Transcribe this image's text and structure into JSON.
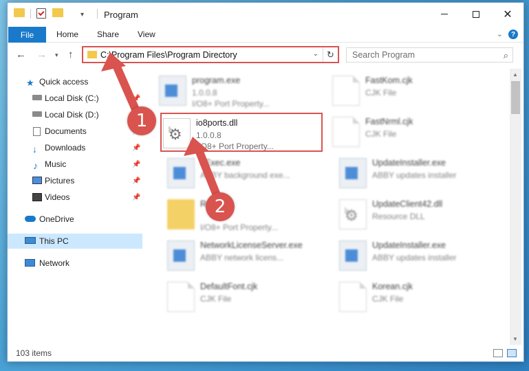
{
  "window": {
    "title": "Program"
  },
  "ribbon": {
    "file": "File",
    "home": "Home",
    "share": "Share",
    "view": "View",
    "help": "?"
  },
  "address": {
    "path": "C:\\Program Files\\Program Directory",
    "search_placeholder": "Search Program"
  },
  "nav_pane": {
    "items": [
      {
        "label": "Quick access",
        "icon": "star-icon",
        "pinned": false
      },
      {
        "label": "Local Disk (C:)",
        "icon": "drive-icon",
        "pinned": true
      },
      {
        "label": "Local Disk (D:)",
        "icon": "drive-icon",
        "pinned": false
      },
      {
        "label": "Documents",
        "icon": "documents-icon",
        "pinned": true
      },
      {
        "label": "Downloads",
        "icon": "download-icon",
        "pinned": true
      },
      {
        "label": "Music",
        "icon": "music-icon",
        "pinned": true
      },
      {
        "label": "Pictures",
        "icon": "pictures-icon",
        "pinned": true
      },
      {
        "label": "Videos",
        "icon": "videos-icon",
        "pinned": true
      },
      {
        "label": "OneDrive",
        "icon": "cloud-icon",
        "pinned": false
      },
      {
        "label": "This PC",
        "icon": "computer-icon",
        "pinned": false,
        "selected": true
      },
      {
        "label": "Network",
        "icon": "network-icon",
        "pinned": false
      }
    ]
  },
  "files": [
    {
      "name": "program.exe",
      "meta1": "1.0.0.8",
      "meta2": "I/O8+ Port Property...",
      "icon": "exe-icon",
      "blurred": true
    },
    {
      "name": "FastKom.cjk",
      "meta1": "CJK File",
      "meta2": "",
      "icon": "doc-icon",
      "blurred": true
    },
    {
      "name": "io8ports.dll",
      "meta1": "1.0.0.8",
      "meta2": "I/O8+ Port Property...",
      "icon": "gear-doc-icon",
      "blurred": false
    },
    {
      "name": "FastNrml.cjk",
      "meta1": "CJK File",
      "meta2": "",
      "icon": "doc-icon",
      "blurred": true
    },
    {
      "name": "eExec.exe",
      "meta1": "ABBY background exe...",
      "meta2": "",
      "icon": "exe-icon",
      "blurred": true
    },
    {
      "name": "UpdateInstaller.exe",
      "meta1": "ABBY updates installer",
      "meta2": "",
      "icon": "exe-icon",
      "blurred": true
    },
    {
      "name": "Res",
      "meta1": "",
      "meta2": "I/O8+ Port Property...",
      "icon": "folder-icon",
      "blurred": true
    },
    {
      "name": "UpdateClient42.dll",
      "meta1": "Resource DLL",
      "meta2": "",
      "icon": "gear-doc-icon",
      "blurred": true
    },
    {
      "name": "NetworkLicenseServer.exe",
      "meta1": "ABBY network licens...",
      "meta2": "",
      "icon": "exe-icon",
      "blurred": true
    },
    {
      "name": "UpdateInstaller.exe",
      "meta1": "ABBY updates installer",
      "meta2": "",
      "icon": "exe-icon",
      "blurred": true
    },
    {
      "name": "DefaultFont.cjk",
      "meta1": "CJK File",
      "meta2": "",
      "icon": "doc-icon",
      "blurred": true
    },
    {
      "name": "Korean.cjk",
      "meta1": "CJK File",
      "meta2": "",
      "icon": "doc-icon",
      "blurred": true
    }
  ],
  "status": {
    "count": "103 items"
  },
  "annotations": {
    "badge1": "1",
    "badge2": "2",
    "color": "#d9534f"
  }
}
